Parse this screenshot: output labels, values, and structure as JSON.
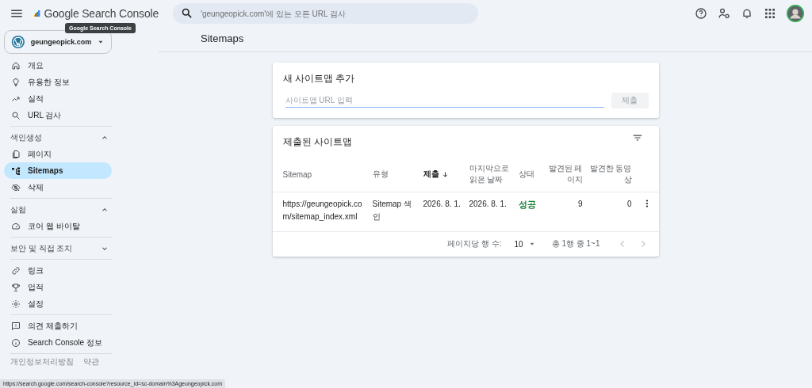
{
  "header": {
    "product": "Google Search Console",
    "tooltip": "Google Search Console",
    "search": {
      "placeholder": "'geungeopick.com'에 있는 모든 URL 검사"
    }
  },
  "property": {
    "name": "geungeopick.com"
  },
  "sidebar": {
    "groups": [
      {
        "items": [
          {
            "label": "개요",
            "selected": false
          },
          {
            "label": "유용한 정보",
            "selected": false
          },
          {
            "label": "실적",
            "selected": false
          },
          {
            "label": "URL 검사",
            "selected": false
          }
        ]
      },
      {
        "title": "색인생성",
        "expanded": true,
        "items": [
          {
            "label": "페이지",
            "selected": false
          },
          {
            "label": "Sitemaps",
            "selected": true
          },
          {
            "label": "삭제",
            "selected": false
          }
        ]
      },
      {
        "title": "실험",
        "expanded": true,
        "items": [
          {
            "label": "코어 웹 바이탈",
            "selected": false
          }
        ]
      },
      {
        "title": "보안 및 직접 조치",
        "expanded": false
      },
      {
        "items": [
          {
            "label": "링크",
            "selected": false
          },
          {
            "label": "업적",
            "selected": false
          },
          {
            "label": "설정",
            "selected": false
          }
        ]
      },
      {
        "items": [
          {
            "label": "의견 제출하기",
            "selected": false
          },
          {
            "label": "Search Console 정보",
            "selected": false
          }
        ]
      }
    ],
    "footer": [
      "개인정보처리방침",
      "약관"
    ]
  },
  "page_title": "Sitemaps",
  "add_card": {
    "title": "새 사이트맵 추가",
    "input": {
      "placeholder": "사이트맵 URL 입력"
    },
    "submit": {
      "label": "제출",
      "disabled": true
    }
  },
  "table_card": {
    "title": "제출된 사이트맵",
    "columns": [
      {
        "label": "Sitemap",
        "sorted": false
      },
      {
        "label": "유형",
        "sorted": false
      },
      {
        "label": "제출",
        "sorted": true
      },
      {
        "label": "마지막으로 읽은 날짜",
        "sorted": false
      },
      {
        "label": "상태",
        "sorted": false
      },
      {
        "label": "발견된 페이지",
        "sorted": false
      },
      {
        "label": "발견한 동영상",
        "sorted": false
      }
    ],
    "rows": [
      {
        "sitemap": "https://geungeopick.com/sitemap_index.xml",
        "type": "Sitemap 색인",
        "submitted": "2026. 8. 1.",
        "last_read": "2026. 8. 1.",
        "status": {
          "text": "성공",
          "color": "#188038"
        },
        "pages": "9",
        "videos": "0"
      }
    ],
    "pagination": {
      "rows_label": "페이지당 행 수:",
      "rows_value": "10",
      "range": "총 1행 중 1~1",
      "prev_disabled": true,
      "next_disabled": true
    }
  },
  "status_bar": "https://search.google.com/search-console?resource_id=sc-domain%3Ageungeopick.com"
}
